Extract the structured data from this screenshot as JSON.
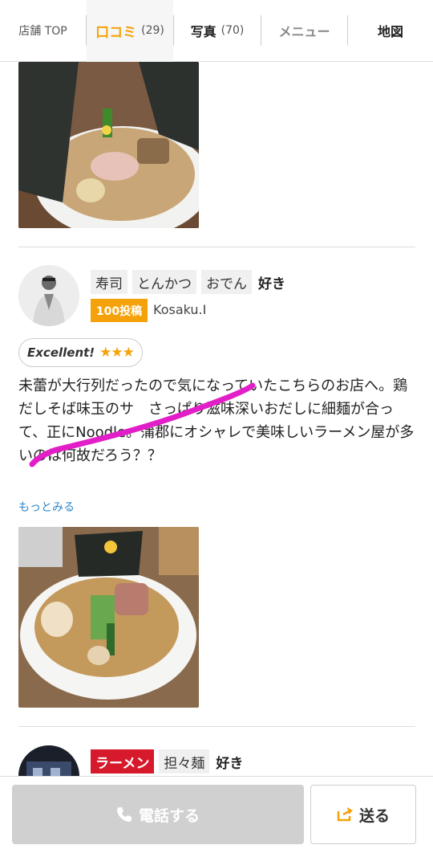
{
  "tabs": [
    {
      "label": "店舗 TOP",
      "count": ""
    },
    {
      "label": "口コミ",
      "count": "(29)"
    },
    {
      "label": "写真",
      "count": "(70)"
    },
    {
      "label": "メニュー",
      "count": ""
    },
    {
      "label": "地図",
      "count": ""
    }
  ],
  "review1": {
    "tags": [
      "寿司",
      "とんかつ",
      "おでん"
    ],
    "likes_label": "好き",
    "posts_badge": "100投稿",
    "username": "Kosaku.I",
    "rating_label": "Excellent!",
    "stars": "★★★",
    "text": "未蕾が大行列だったので気になっていたこちらのお店へ。鶏だしそば味玉のサ　さっぱり滋味深いおだしに細麺が合って、正にNoodle。蒲郡にオシャレで美味しいラーメン屋が多いのは何故だろう？？",
    "more_link": "もっとみる"
  },
  "review2": {
    "tags": [
      "ラーメン",
      "担々麺"
    ],
    "likes_label": "好き"
  },
  "bottom": {
    "call_label": "電話する",
    "send_label": "送る"
  },
  "colors": {
    "accent": "#f5a20a",
    "link": "#2a86c9",
    "ramen_tag": "#d71a2b",
    "scribble": "#e21ec8"
  }
}
